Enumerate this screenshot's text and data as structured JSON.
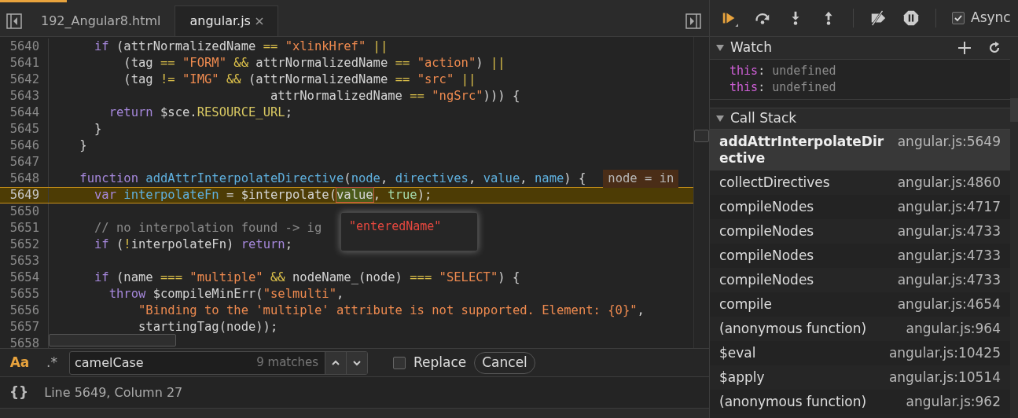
{
  "tabs": [
    {
      "label": "192_Angular8.html",
      "selected": false,
      "closable": false
    },
    {
      "label": "angular.js",
      "selected": true,
      "closable": true
    }
  ],
  "editor": {
    "lines": [
      {
        "number": "5640",
        "current": false,
        "tokens": [
          {
            "kind": "kw",
            "text": "      if"
          },
          {
            "kind": "plain",
            "text": " (attrNormalizedName"
          },
          {
            "kind": "op",
            "text": " =="
          },
          {
            "kind": "str",
            "text": " \"xlinkHref\""
          },
          {
            "kind": "op",
            "text": " ||"
          }
        ]
      },
      {
        "number": "5641",
        "current": false,
        "tokens": [
          {
            "kind": "plain",
            "text": "          (tag"
          },
          {
            "kind": "op",
            "text": " =="
          },
          {
            "kind": "str",
            "text": " \"FORM\""
          },
          {
            "kind": "op",
            "text": " &&"
          },
          {
            "kind": "plain",
            "text": " attrNormalizedName"
          },
          {
            "kind": "op",
            "text": " =="
          },
          {
            "kind": "str",
            "text": " \"action\""
          },
          {
            "kind": "plain",
            "text": ")"
          },
          {
            "kind": "op",
            "text": " ||"
          }
        ]
      },
      {
        "number": "5642",
        "current": false,
        "tokens": [
          {
            "kind": "plain",
            "text": "          (tag"
          },
          {
            "kind": "op",
            "text": " !="
          },
          {
            "kind": "str",
            "text": " \"IMG\""
          },
          {
            "kind": "op",
            "text": " &&"
          },
          {
            "kind": "plain",
            "text": " (attrNormalizedName"
          },
          {
            "kind": "op",
            "text": " =="
          },
          {
            "kind": "str",
            "text": " \"src\""
          },
          {
            "kind": "op",
            "text": " ||"
          }
        ]
      },
      {
        "number": "5643",
        "current": false,
        "tokens": [
          {
            "kind": "plain",
            "text": "                              attrNormalizedName"
          },
          {
            "kind": "op",
            "text": " =="
          },
          {
            "kind": "str",
            "text": " \"ngSrc\""
          },
          {
            "kind": "plain",
            "text": "))) {"
          }
        ]
      },
      {
        "number": "5644",
        "current": false,
        "tokens": [
          {
            "kind": "kw",
            "text": "        return"
          },
          {
            "kind": "plain",
            "text": " $sce."
          },
          {
            "kind": "const",
            "text": "RESOURCE_URL"
          },
          {
            "kind": "plain",
            "text": ";"
          }
        ]
      },
      {
        "number": "5645",
        "current": false,
        "tokens": [
          {
            "kind": "plain",
            "text": "      }"
          }
        ]
      },
      {
        "number": "5646",
        "current": false,
        "tokens": [
          {
            "kind": "plain",
            "text": "    }"
          }
        ]
      },
      {
        "number": "5647",
        "current": false
      },
      {
        "number": "5648",
        "current": false,
        "inline_value": "node = in",
        "tokens": [
          {
            "kind": "kw",
            "text": "    function"
          },
          {
            "kind": "def",
            "text": " addAttrInterpolateDirective"
          },
          {
            "kind": "plain",
            "text": "("
          },
          {
            "kind": "def",
            "text": "node"
          },
          {
            "kind": "plain",
            "text": ","
          },
          {
            "kind": "def",
            "text": " directives"
          },
          {
            "kind": "plain",
            "text": ","
          },
          {
            "kind": "def",
            "text": " value"
          },
          {
            "kind": "plain",
            "text": ","
          },
          {
            "kind": "def",
            "text": " name"
          },
          {
            "kind": "plain",
            "text": ") {"
          }
        ]
      },
      {
        "number": "5649",
        "current": true,
        "tokens": [
          {
            "kind": "kw",
            "text": "      var"
          },
          {
            "kind": "def",
            "text": " interpolateFn"
          },
          {
            "kind": "plain",
            "text": " = $interpolate("
          },
          {
            "kind": "hover",
            "text": "value"
          },
          {
            "kind": "plain",
            "text": ","
          },
          {
            "kind": "lit",
            "text": " true"
          },
          {
            "kind": "plain",
            "text": ");"
          }
        ]
      },
      {
        "number": "5650",
        "current": false
      },
      {
        "number": "5651",
        "current": false,
        "tokens": [
          {
            "kind": "com",
            "text": "      // no interpolation found -> ig"
          }
        ]
      },
      {
        "number": "5652",
        "current": false,
        "tokens": [
          {
            "kind": "kw",
            "text": "      if"
          },
          {
            "kind": "plain",
            "text": " ("
          },
          {
            "kind": "op",
            "text": "!"
          },
          {
            "kind": "plain",
            "text": "interpolateFn)"
          },
          {
            "kind": "kw",
            "text": " return"
          },
          {
            "kind": "plain",
            "text": ";"
          }
        ]
      },
      {
        "number": "5653",
        "current": false
      },
      {
        "number": "5654",
        "current": false,
        "tokens": [
          {
            "kind": "kw",
            "text": "      if"
          },
          {
            "kind": "plain",
            "text": " (name"
          },
          {
            "kind": "op",
            "text": " ==="
          },
          {
            "kind": "str",
            "text": " \"multiple\""
          },
          {
            "kind": "op",
            "text": " &&"
          },
          {
            "kind": "plain",
            "text": " nodeName_(node)"
          },
          {
            "kind": "op",
            "text": " ==="
          },
          {
            "kind": "str",
            "text": " \"SELECT\""
          },
          {
            "kind": "plain",
            "text": ") {"
          }
        ]
      },
      {
        "number": "5655",
        "current": false,
        "tokens": [
          {
            "kind": "kw",
            "text": "        throw"
          },
          {
            "kind": "plain",
            "text": " $compileMinErr("
          },
          {
            "kind": "str",
            "text": "\"selmulti\""
          },
          {
            "kind": "plain",
            "text": ","
          }
        ]
      },
      {
        "number": "5656",
        "current": false,
        "tokens": [
          {
            "kind": "str",
            "text": "            \"Binding to the 'multiple' attribute is not supported. Element: {0}\""
          },
          {
            "kind": "plain",
            "text": ","
          }
        ]
      },
      {
        "number": "5657",
        "current": false,
        "tokens": [
          {
            "kind": "plain",
            "text": "            startingTag(node));"
          }
        ]
      },
      {
        "number": "5658",
        "current": false
      }
    ],
    "popover": {
      "value": "\"enteredName\""
    }
  },
  "search": {
    "case_sensitive": true,
    "case_label": "Aa",
    "regex": false,
    "regex_label": ".*",
    "value": "camelCase",
    "count": "9 matches",
    "replace_checked": false,
    "replace_label": "Replace",
    "cancel": "Cancel"
  },
  "status_bar": {
    "braces": "{}",
    "position": "Line 5649, Column 27"
  },
  "debugger": {
    "async_checked": true,
    "async_label": "Async",
    "watch": {
      "title": "Watch",
      "expanded": true,
      "items": [
        {
          "name": "this",
          "separator": ":",
          "value": "undefined"
        },
        {
          "name": "this",
          "separator": ":",
          "value": "undefined"
        }
      ]
    },
    "call_stack": {
      "title": "Call Stack",
      "expanded": true,
      "frames": [
        {
          "name": "addAttrInterpolateDirective",
          "location": "angular.js:5649",
          "selected": true
        },
        {
          "name": "collectDirectives",
          "location": "angular.js:4860",
          "selected": false
        },
        {
          "name": "compileNodes",
          "location": "angular.js:4717",
          "selected": false
        },
        {
          "name": "compileNodes",
          "location": "angular.js:4733",
          "selected": false
        },
        {
          "name": "compileNodes",
          "location": "angular.js:4733",
          "selected": false
        },
        {
          "name": "compileNodes",
          "location": "angular.js:4733",
          "selected": false
        },
        {
          "name": "compile",
          "location": "angular.js:4654",
          "selected": false
        },
        {
          "name": "(anonymous function)",
          "location": "angular.js:964",
          "selected": false
        },
        {
          "name": "$eval",
          "location": "angular.js:10425",
          "selected": false
        },
        {
          "name": "$apply",
          "location": "angular.js:10514",
          "selected": false
        },
        {
          "name": "(anonymous function)",
          "location": "angular.js:962",
          "selected": false
        }
      ]
    }
  }
}
